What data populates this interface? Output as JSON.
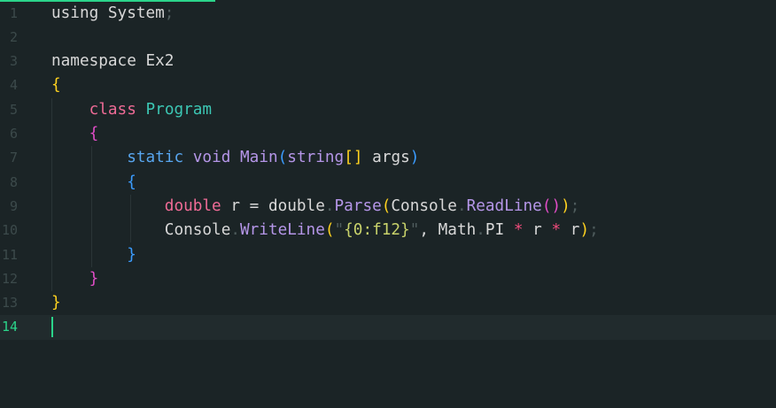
{
  "editor": {
    "accent_color": "#2bd48a",
    "background": "#1b2426",
    "current_line": 14,
    "lines": [
      {
        "n": "1",
        "tokens": [
          [
            "using System",
            "plain"
          ],
          [
            ";",
            "dim"
          ]
        ]
      },
      {
        "n": "2",
        "tokens": []
      },
      {
        "n": "3",
        "tokens": [
          [
            "namespace Ex2",
            "plain"
          ]
        ]
      },
      {
        "n": "4",
        "tokens": [
          [
            "{",
            "brace-y"
          ]
        ]
      },
      {
        "n": "5",
        "tokens": [
          [
            "    ",
            "plain"
          ],
          [
            "class",
            "kw-pink"
          ],
          [
            " ",
            "plain"
          ],
          [
            "Program",
            "type-teal"
          ]
        ]
      },
      {
        "n": "6",
        "tokens": [
          [
            "    ",
            "plain"
          ],
          [
            "{",
            "brace-p"
          ]
        ]
      },
      {
        "n": "7",
        "tokens": [
          [
            "        ",
            "plain"
          ],
          [
            "static",
            "kw-blue"
          ],
          [
            " ",
            "plain"
          ],
          [
            "void",
            "method"
          ],
          [
            " ",
            "plain"
          ],
          [
            "Main",
            "method"
          ],
          [
            "(",
            "brace-b"
          ],
          [
            "string",
            "method"
          ],
          [
            "[]",
            "brace-y"
          ],
          [
            " args",
            "plain"
          ],
          [
            ")",
            "brace-b"
          ]
        ]
      },
      {
        "n": "8",
        "tokens": [
          [
            "        ",
            "plain"
          ],
          [
            "{",
            "brace-b"
          ]
        ]
      },
      {
        "n": "9",
        "tokens": [
          [
            "            ",
            "plain"
          ],
          [
            "double",
            "kw-pink"
          ],
          [
            " r = double",
            "plain"
          ],
          [
            ".",
            "dim"
          ],
          [
            "Parse",
            "method"
          ],
          [
            "(",
            "brace-y"
          ],
          [
            "Console",
            "plain"
          ],
          [
            ".",
            "dim"
          ],
          [
            "ReadLine",
            "method"
          ],
          [
            "()",
            "brace-p"
          ],
          [
            ")",
            "brace-y"
          ],
          [
            ";",
            "dim"
          ]
        ]
      },
      {
        "n": "10",
        "tokens": [
          [
            "            ",
            "plain"
          ],
          [
            "Console",
            "plain"
          ],
          [
            ".",
            "dim"
          ],
          [
            "WriteLine",
            "method"
          ],
          [
            "(",
            "brace-y"
          ],
          [
            "\"",
            "dim"
          ],
          [
            "{0:f12}",
            "str"
          ],
          [
            "\"",
            "dim"
          ],
          [
            ", Math",
            "plain"
          ],
          [
            ".",
            "dim"
          ],
          [
            "PI ",
            "plain"
          ],
          [
            "*",
            "op"
          ],
          [
            " r ",
            "plain"
          ],
          [
            "*",
            "op"
          ],
          [
            " r",
            "plain"
          ],
          [
            ")",
            "brace-y"
          ],
          [
            ";",
            "dim"
          ]
        ]
      },
      {
        "n": "11",
        "tokens": [
          [
            "        ",
            "plain"
          ],
          [
            "}",
            "brace-b"
          ]
        ]
      },
      {
        "n": "12",
        "tokens": [
          [
            "    ",
            "plain"
          ],
          [
            "}",
            "brace-p"
          ]
        ]
      },
      {
        "n": "13",
        "tokens": [
          [
            "}",
            "brace-y"
          ]
        ]
      },
      {
        "n": "14",
        "tokens": []
      }
    ]
  }
}
